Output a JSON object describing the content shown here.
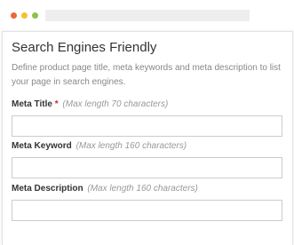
{
  "colors": {
    "dot_red": "#f0643c",
    "dot_yellow": "#f5c02d",
    "dot_green": "#8bc34a",
    "required_mark": "#c62828"
  },
  "section": {
    "title": "Search Engines Friendly",
    "description": "Define product page title, meta keywords and meta description to list your page in search engines."
  },
  "fields": {
    "meta_title": {
      "label": "Meta Title",
      "required_mark": "*",
      "hint": "(Max length 70 characters)",
      "value": ""
    },
    "meta_keyword": {
      "label": "Meta Keyword",
      "hint": "(Max length 160 characters)",
      "value": ""
    },
    "meta_description": {
      "label": "Meta Description",
      "hint": "(Max length 160 characters)",
      "value": ""
    }
  }
}
